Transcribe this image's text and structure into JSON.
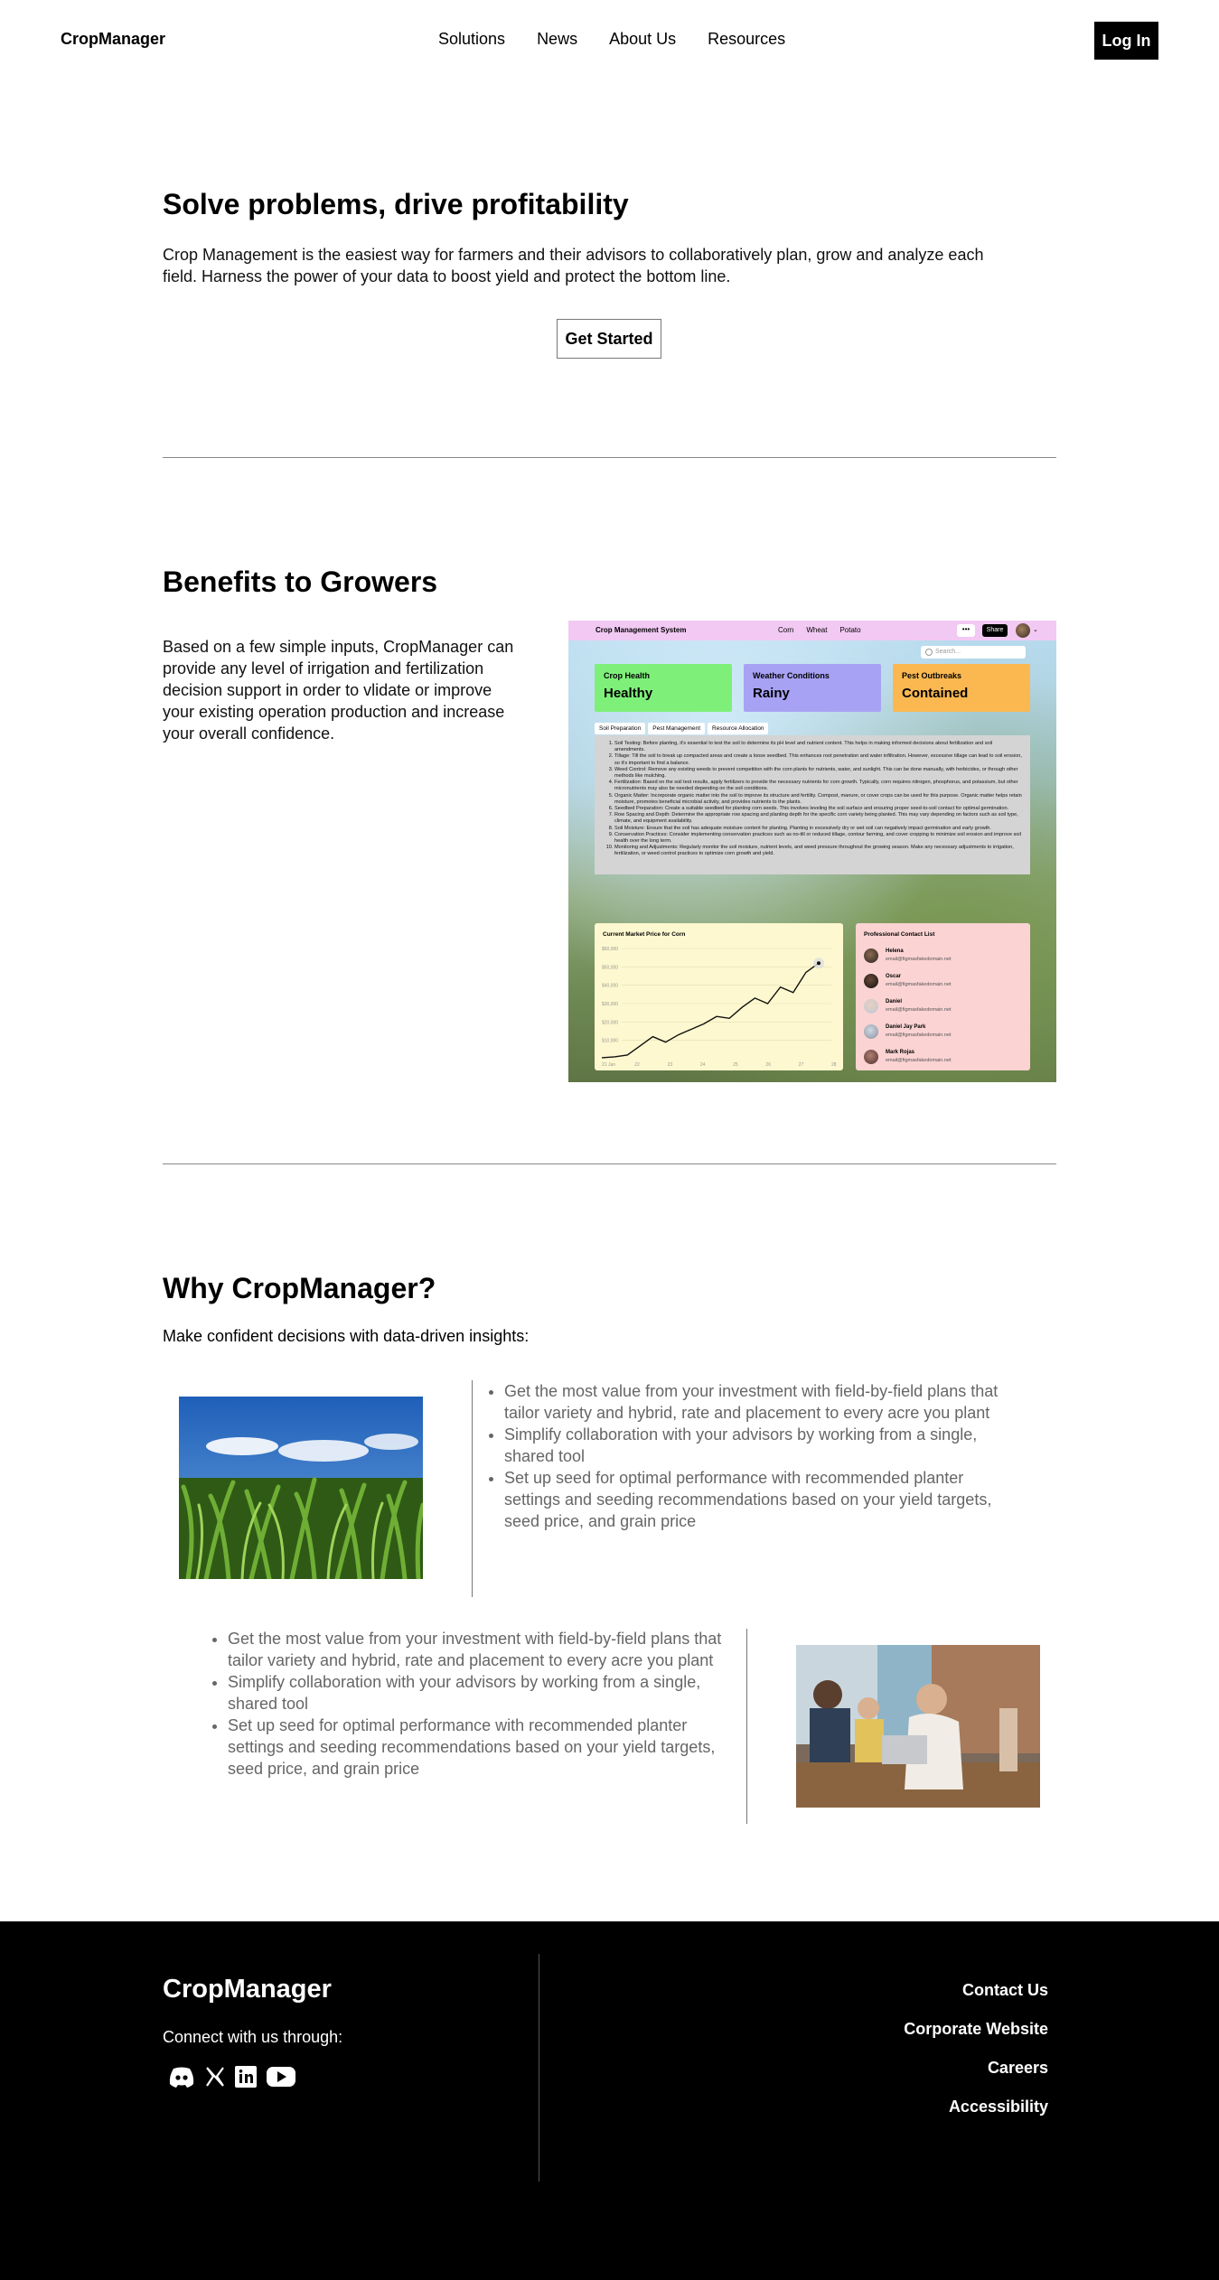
{
  "nav": {
    "brand": "CropManager",
    "links": [
      "Solutions",
      "News",
      "About Us",
      "Resources"
    ],
    "login": "Log In"
  },
  "hero": {
    "title": "Solve problems, drive profitability",
    "text": "Crop Management is the easiest way for farmers and their advisors to collaboratively plan, grow and analyze each field. Harness the power of your data to boost yield and protect the bottom line.",
    "cta": "Get Started"
  },
  "benefits": {
    "title": "Benefits to Growers",
    "text": "Based on a few simple inputs, CropManager can provide any level of irrigation and fertilization decision support in order to vlidate or improve your existing operation production and increase your overall confidence.",
    "mock": {
      "app_title": "Crop Management System",
      "links": [
        "Corn",
        "Wheat",
        "Potato"
      ],
      "more": "•••",
      "share": "Share",
      "search_placeholder": "Search...",
      "cards": [
        {
          "label": "Crop Health",
          "value": "Healthy",
          "color": "#7ef07a"
        },
        {
          "label": "Weather Conditions",
          "value": "Rainy",
          "color": "#a8a2f5"
        },
        {
          "label": "Pest Outbreaks",
          "value": "Contained",
          "color": "#fbb851"
        }
      ],
      "tabs": [
        "Soil Preparation",
        "Pest Management",
        "Resource Allocation"
      ],
      "steps": [
        "Soil Testing: Before planting, it's essential to test the soil to determine its pH level and nutrient content. This helps in making informed decisions about fertilization and soil amendments.",
        "Tillage: Till the soil to break up compacted areas and create a loose seedbed. This enhances root penetration and water infiltration. However, excessive tillage can lead to soil erosion, so it's important to find a balance.",
        "Weed Control: Remove any existing weeds to prevent competition with the corn plants for nutrients, water, and sunlight. This can be done manually, with herbicides, or through other methods like mulching.",
        "Fertilization: Based on the soil test results, apply fertilizers to provide the necessary nutrients for corn growth. Typically, corn requires nitrogen, phosphorus, and potassium, but other micronutrients may also be needed depending on the soil conditions.",
        "Organic Matter: Incorporate organic matter into the soil to improve its structure and fertility. Compost, manure, or cover crops can be used for this purpose. Organic matter helps retain moisture, promotes beneficial microbial activity, and provides nutrients to the plants.",
        "Seedbed Preparation: Create a suitable seedbed for planting corn seeds. This involves leveling the soil surface and ensuring proper seed-to-soil contact for optimal germination.",
        "Row Spacing and Depth: Determine the appropriate row spacing and planting depth for the specific corn variety being planted. This may vary depending on factors such as soil type, climate, and equipment availability.",
        "Soil Moisture: Ensure that the soil has adequate moisture content for planting. Planting in excessively dry or wet soil can negatively impact germination and early growth.",
        "Conservation Practices: Consider implementing conservation practices such as no-till or reduced tillage, contour farming, and cover cropping to minimize soil erosion and improve soil health over the long term.",
        "Monitoring and Adjustments: Regularly monitor the soil moisture, nutrient levels, and weed pressure throughout the growing season. Make any necessary adjustments to irrigation, fertilization, or weed control practices to optimize corn growth and yield."
      ],
      "chart_title": "Current Market Price for Corn",
      "chart_data": {
        "type": "line",
        "y_ticks": [
          "$60,000",
          "$50,000",
          "$40,000",
          "$30,000",
          "$20,000",
          "$10,000"
        ],
        "x_ticks": [
          "21 Jan",
          "22",
          "23",
          "24",
          "25",
          "26",
          "27",
          "28"
        ],
        "ylim": [
          0,
          60000
        ],
        "values": [
          500,
          1000,
          2000,
          7000,
          12000,
          9000,
          13000,
          16000,
          19000,
          23000,
          22000,
          28000,
          33000,
          30000,
          39000,
          36000,
          47000,
          52000
        ]
      },
      "contacts_title": "Professional Contact List",
      "contacts": [
        {
          "name": "Helena",
          "email": "email@figmasfakedomain.net"
        },
        {
          "name": "Oscar",
          "email": "email@figmasfakedomain.net"
        },
        {
          "name": "Daniel",
          "email": "email@figmasfakedomain.net"
        },
        {
          "name": "Daniel Jay Park",
          "email": "email@figmasfakedomain.net"
        },
        {
          "name": "Mark Rojas",
          "email": "email@figmasfakedomain.net"
        }
      ]
    }
  },
  "why": {
    "title": "Why CropManager?",
    "subtitle": "Make confident decisions with data-driven insights:",
    "bullets": [
      "Get the most value from your investment with field-by-field plans that tailor variety and hybrid, rate and placement to every acre you plant",
      "Simplify collaboration with your advisors by working from a single, shared tool",
      "Set up seed for optimal performance with recommended planter settings and seeding recommendations based on your yield targets, seed price, and grain price"
    ]
  },
  "footer": {
    "brand": "CropManager",
    "connect": "Connect with us through:",
    "socials": [
      "discord-icon",
      "x-icon",
      "linkedin-icon",
      "youtube-icon"
    ],
    "links": [
      "Contact Us",
      "Corporate Website",
      "Careers",
      "Accessibility"
    ]
  }
}
